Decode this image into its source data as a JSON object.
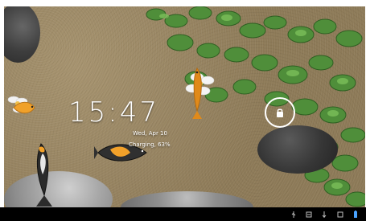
{
  "lockscreen": {
    "time": "15:47",
    "date": "Wed, Apr 10",
    "charging": "Charging, 63%"
  },
  "status_bar": {
    "icons": [
      "usb-icon",
      "debug-icon",
      "usb-storage-icon",
      "screenshot-icon",
      "battery-icon"
    ]
  }
}
